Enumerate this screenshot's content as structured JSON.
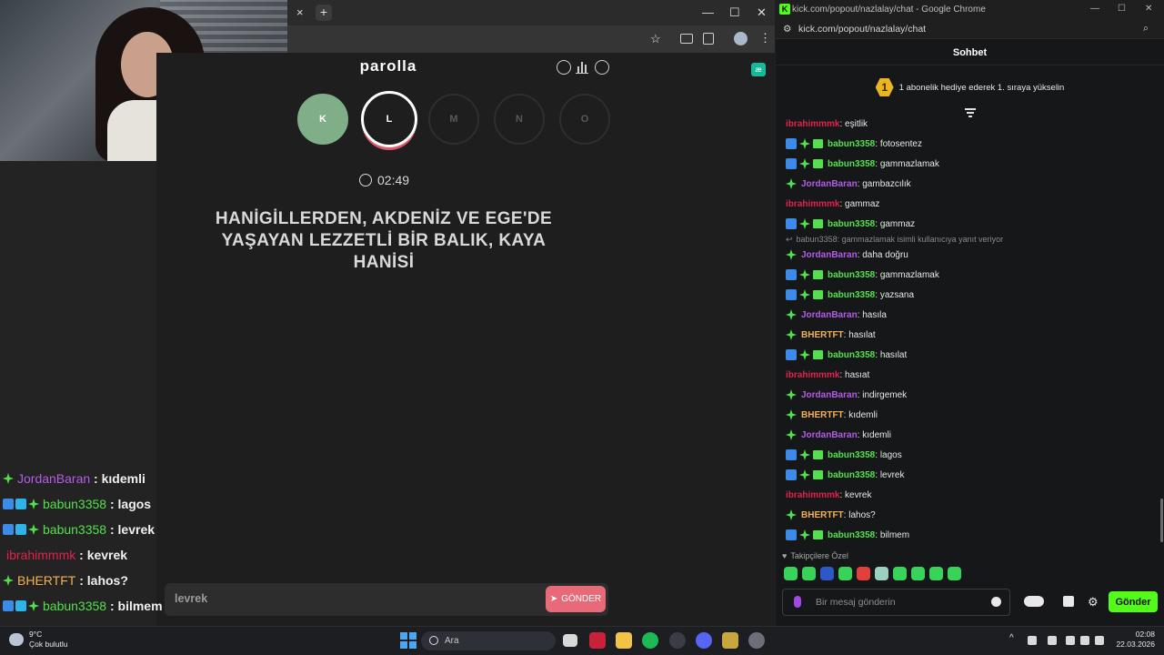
{
  "browser": {
    "tab_close": "×",
    "new_tab": "+",
    "window_controls": [
      "—",
      "☐",
      "✕"
    ]
  },
  "game": {
    "title": "parolla",
    "letters": [
      {
        "char": "K",
        "state": "correct"
      },
      {
        "char": "L",
        "state": "active"
      },
      {
        "char": "M",
        "state": "pending"
      },
      {
        "char": "N",
        "state": "pending"
      },
      {
        "char": "O",
        "state": "pending"
      }
    ],
    "timer": "02:49",
    "question": "HANİGİLLERDEN, AKDENİZ VE EGE'DE YAŞAYAN LEZZETLİ BİR BALIK, KAYA HANİSİ",
    "answer_value": "levrek",
    "send_label": "GÖNDER",
    "accent_color": "#e86a78",
    "correct_color": "#7fae88"
  },
  "overlay_chat": [
    {
      "user": "JordanBaran",
      "text": "kıdemli",
      "color": "#b45ce6",
      "badges": [
        "star"
      ]
    },
    {
      "user": "babun3358",
      "text": "lagos",
      "color": "#54e04e",
      "badges": [
        "sq",
        "cube",
        "star"
      ]
    },
    {
      "user": "babun3358",
      "text": "levrek",
      "color": "#54e04e",
      "badges": [
        "sq",
        "cube",
        "star"
      ]
    },
    {
      "user": "ibrahimmmk",
      "text": "kevrek",
      "color": "#e0234e",
      "badges": []
    },
    {
      "user": "BHERTFT",
      "text": "lahos?",
      "color": "#f2b155",
      "badges": [
        "star"
      ]
    },
    {
      "user": "babun3358",
      "text": "bilmem",
      "color": "#54e04e",
      "badges": [
        "sq",
        "cube",
        "star"
      ]
    }
  ],
  "chat_window": {
    "window_title": "kick.com/popout/nazlalay/chat - Google Chrome",
    "url": "kick.com/popout/nazlalay/chat",
    "header": "Sohbet",
    "promo_rank": "1",
    "promo_text": "1 abonelik hediye ederek 1. sıraya yükselin",
    "reply_text": "babun3358: gammazlamak isimli kullanıcıya yanıt veriyor",
    "messages": [
      {
        "user": "ibrahimmmk",
        "text": "eşitlik",
        "color": "#e0234e",
        "badges": []
      },
      {
        "user": "babun3358",
        "text": "fotosentez",
        "color": "#54e04e",
        "badges": [
          "sq",
          "star",
          "gift"
        ]
      },
      {
        "user": "babun3358",
        "text": "gammazlamak",
        "color": "#54e04e",
        "badges": [
          "sq",
          "star",
          "gift"
        ]
      },
      {
        "user": "JordanBaran",
        "text": "gambazcılık",
        "color": "#b45ce6",
        "badges": [
          "star"
        ]
      },
      {
        "user": "ibrahimmmk",
        "text": "gammaz",
        "color": "#e0234e",
        "badges": []
      },
      {
        "user": "babun3358",
        "text": "gammaz",
        "color": "#54e04e",
        "badges": [
          "sq",
          "star",
          "gift"
        ]
      },
      {
        "user": "JordanBaran",
        "text": "daha doğru",
        "color": "#b45ce6",
        "badges": [
          "star"
        ]
      },
      {
        "user": "babun3358",
        "text": "gammazlamak",
        "color": "#54e04e",
        "badges": [
          "sq",
          "star",
          "gift"
        ]
      },
      {
        "user": "babun3358",
        "text": "yazsana",
        "color": "#54e04e",
        "badges": [
          "sq",
          "star",
          "gift"
        ]
      },
      {
        "user": "JordanBaran",
        "text": "hasıla",
        "color": "#b45ce6",
        "badges": [
          "star"
        ]
      },
      {
        "user": "BHERTFT",
        "text": "hasılat",
        "color": "#f2b155",
        "badges": [
          "star"
        ]
      },
      {
        "user": "babun3358",
        "text": "hasılat",
        "color": "#54e04e",
        "badges": [
          "sq",
          "star",
          "gift"
        ]
      },
      {
        "user": "ibrahimmmk",
        "text": "hasıat",
        "color": "#e0234e",
        "badges": []
      },
      {
        "user": "JordanBaran",
        "text": "indirgemek",
        "color": "#b45ce6",
        "badges": [
          "star"
        ]
      },
      {
        "user": "BHERTFT",
        "text": "kıdemli",
        "color": "#f2b155",
        "badges": [
          "star"
        ]
      },
      {
        "user": "JordanBaran",
        "text": "kıdemli",
        "color": "#b45ce6",
        "badges": [
          "star"
        ]
      },
      {
        "user": "babun3358",
        "text": "lagos",
        "color": "#54e04e",
        "badges": [
          "sq",
          "star",
          "gift"
        ]
      },
      {
        "user": "babun3358",
        "text": "levrek",
        "color": "#54e04e",
        "badges": [
          "sq",
          "star",
          "gift"
        ]
      },
      {
        "user": "ibrahimmmk",
        "text": "kevrek",
        "color": "#e0234e",
        "badges": []
      },
      {
        "user": "BHERTFT",
        "text": "lahos?",
        "color": "#f2b155",
        "badges": [
          "star"
        ]
      },
      {
        "user": "babun3358",
        "text": "bilmem",
        "color": "#54e04e",
        "badges": [
          "sq",
          "star",
          "gift"
        ]
      }
    ],
    "followers_label": "Takipçilere Özel",
    "input_placeholder": "Bir mesaj gönderin",
    "send_label": "Gönder",
    "accent_color": "#53fc18"
  },
  "taskbar": {
    "temperature": "9°C",
    "weather": "Çok bulutlu",
    "search_placeholder": "Ara",
    "time": "02:08",
    "date": "22.03.2026"
  }
}
